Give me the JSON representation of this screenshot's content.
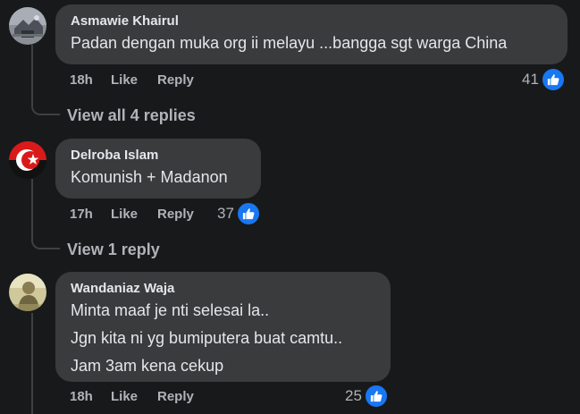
{
  "colors": {
    "background": "#18191a",
    "bubble": "#3a3b3c",
    "text_primary": "#e4e6eb",
    "text_secondary": "#b0b3b8",
    "like_blue": "#1877f2"
  },
  "comments": [
    {
      "author": "Asmawie Khairul",
      "lines": [
        "Padan dengan muka org ii melayu ...bangga sgt warga China"
      ],
      "time": "18h",
      "like_label": "Like",
      "reply_label": "Reply",
      "reaction_count": "41",
      "reaction_icon": "like-icon",
      "replies_link": "View all 4 replies"
    },
    {
      "author": "Delroba Islam",
      "lines": [
        "Komunish + Madanon"
      ],
      "time": "17h",
      "like_label": "Like",
      "reply_label": "Reply",
      "reaction_count": "37",
      "reaction_icon": "like-icon",
      "replies_link": "View 1 reply"
    },
    {
      "author": "Wandaniaz Waja",
      "lines": [
        "Minta maaf je nti selesai la..",
        "Jgn kita ni yg bumiputera buat camtu..",
        "Jam 3am kena cekup"
      ],
      "time": "18h",
      "like_label": "Like",
      "reply_label": "Reply",
      "reaction_count": "25",
      "reaction_icon": "like-icon"
    }
  ]
}
